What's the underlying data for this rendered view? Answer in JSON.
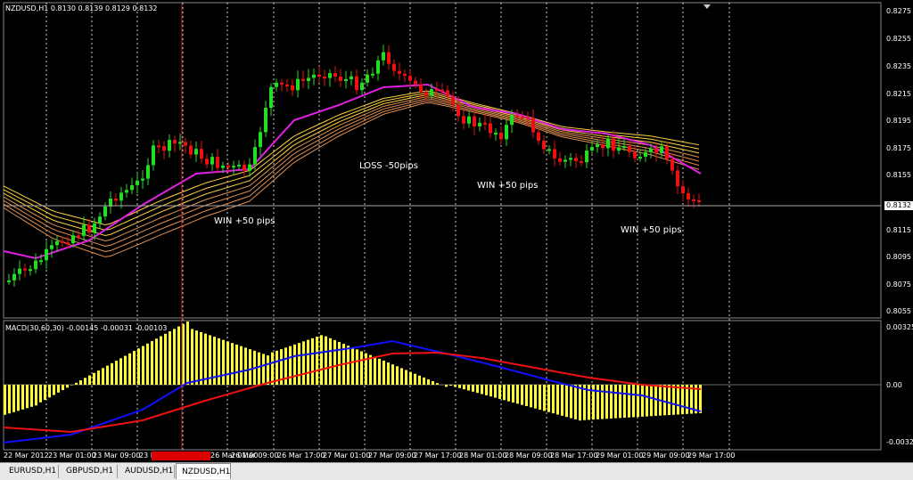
{
  "main_panel": {
    "title": "NZDUSD,H1  0.8130 0.8139 0.8129 0.8132",
    "price_labels": [
      "0.8275",
      "0.8255",
      "0.8235",
      "0.8215",
      "0.8195",
      "0.8175",
      "0.8155",
      "0.8115",
      "0.8095",
      "0.8075",
      "0.8055"
    ],
    "current_price": "0.8132",
    "annotations": [
      "WIN +50 pips",
      "LOSS -50pips",
      "WIN +50 pips",
      "WIN +50 pips"
    ]
  },
  "macd_panel": {
    "title": "MACD(30,60,30) -0.00145 -0.00031 -0.00103",
    "value_labels": [
      "0.00325",
      "0.00",
      "-0.00325"
    ]
  },
  "time_axis": {
    "labels": [
      "22 Mar 2012",
      "23 Mar 01:00",
      "23 Mar 09:00",
      "23 M",
      "26 Mar 01:00",
      "26 Mar 09:00",
      "26 Mar 17:00",
      "27 Mar 01:00",
      "27 Mar 09:00",
      "27 Mar 17:00",
      "28 Mar 01:00",
      "28 Mar 09:00",
      "28 Mar 17:00",
      "29 Mar 01:00",
      "29 Mar 09:00",
      "29 Mar 17:00"
    ]
  },
  "tabs": [
    "EURUSD,H1",
    "GBPUSD,H1",
    "AUDUSD,H1",
    "NZDUSD,H1"
  ],
  "active_tab": "NZDUSD,H1",
  "colors": {
    "bull_candle": "#22dd22",
    "bear_candle": "#ee1111",
    "ma_magenta": "#e020e0",
    "ribbon_yellow": "#ffd040",
    "ribbon_orange": "#e09050",
    "macd_histogram": "#ffff33",
    "macd_signal": "#1010ff",
    "macd_slow": "#ee1111",
    "crosshair": "#cc2222"
  }
}
